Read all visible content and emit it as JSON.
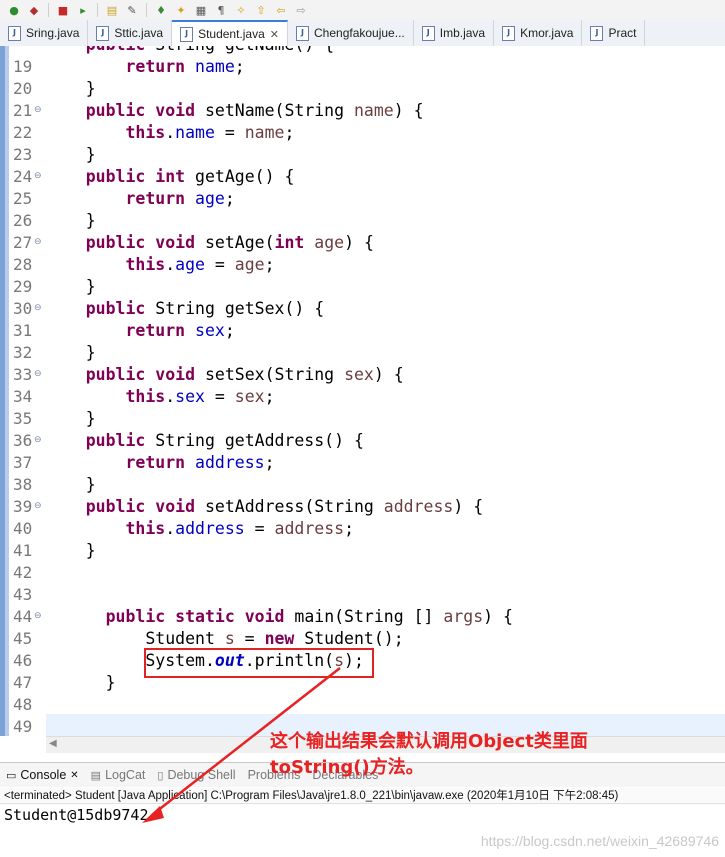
{
  "toolbar": {
    "icons": [
      "run-icon",
      "debug-icon",
      "stop-icon",
      "step-icon",
      "open-icon",
      "tools-icon",
      "pin-icon",
      "mark-icon",
      "bookmark-icon",
      "pilcrow-icon",
      "lamp-icon",
      "up-icon",
      "back-icon",
      "forward-icon"
    ]
  },
  "tabs": [
    {
      "label": "Sring.java",
      "active": false
    },
    {
      "label": "Sttic.java",
      "active": false
    },
    {
      "label": "Student.java",
      "active": true
    },
    {
      "label": "Chengfakoujue...",
      "active": false
    },
    {
      "label": "Imb.java",
      "active": false
    },
    {
      "label": "Kmor.java",
      "active": false
    },
    {
      "label": "Pract",
      "active": false
    }
  ],
  "editor": {
    "line_numbers": [
      "19",
      "20",
      "21",
      "22",
      "23",
      "24",
      "25",
      "26",
      "27",
      "28",
      "29",
      "30",
      "31",
      "32",
      "33",
      "34",
      "35",
      "36",
      "37",
      "38",
      "39",
      "40",
      "41",
      "42",
      "43",
      "44",
      "45",
      "46",
      "47",
      "48",
      "49"
    ],
    "top_partial": "public String getName() {"
  },
  "console": {
    "tabs": [
      {
        "label": "Console",
        "active": true
      },
      {
        "label": "LogCat",
        "active": false
      },
      {
        "label": "Debug Shell",
        "active": false
      },
      {
        "label": "Problems",
        "active": false
      },
      {
        "label": "Declarables",
        "active": false
      }
    ],
    "status": "<terminated> Student [Java Application] C:\\Program Files\\Java\\jre1.8.0_221\\bin\\javaw.exe (2020年1月10日 下午2:08:45)",
    "output": "Student@15db9742"
  },
  "annotation": {
    "line1": "这个输出结果会默认调用Object类里面",
    "line2": "toString()方法。"
  },
  "watermark": "https://blog.csdn.net/weixin_42689746",
  "colors": {
    "annotation": "#e82222",
    "keyword": "#7f0055",
    "field": "#0000c0"
  }
}
